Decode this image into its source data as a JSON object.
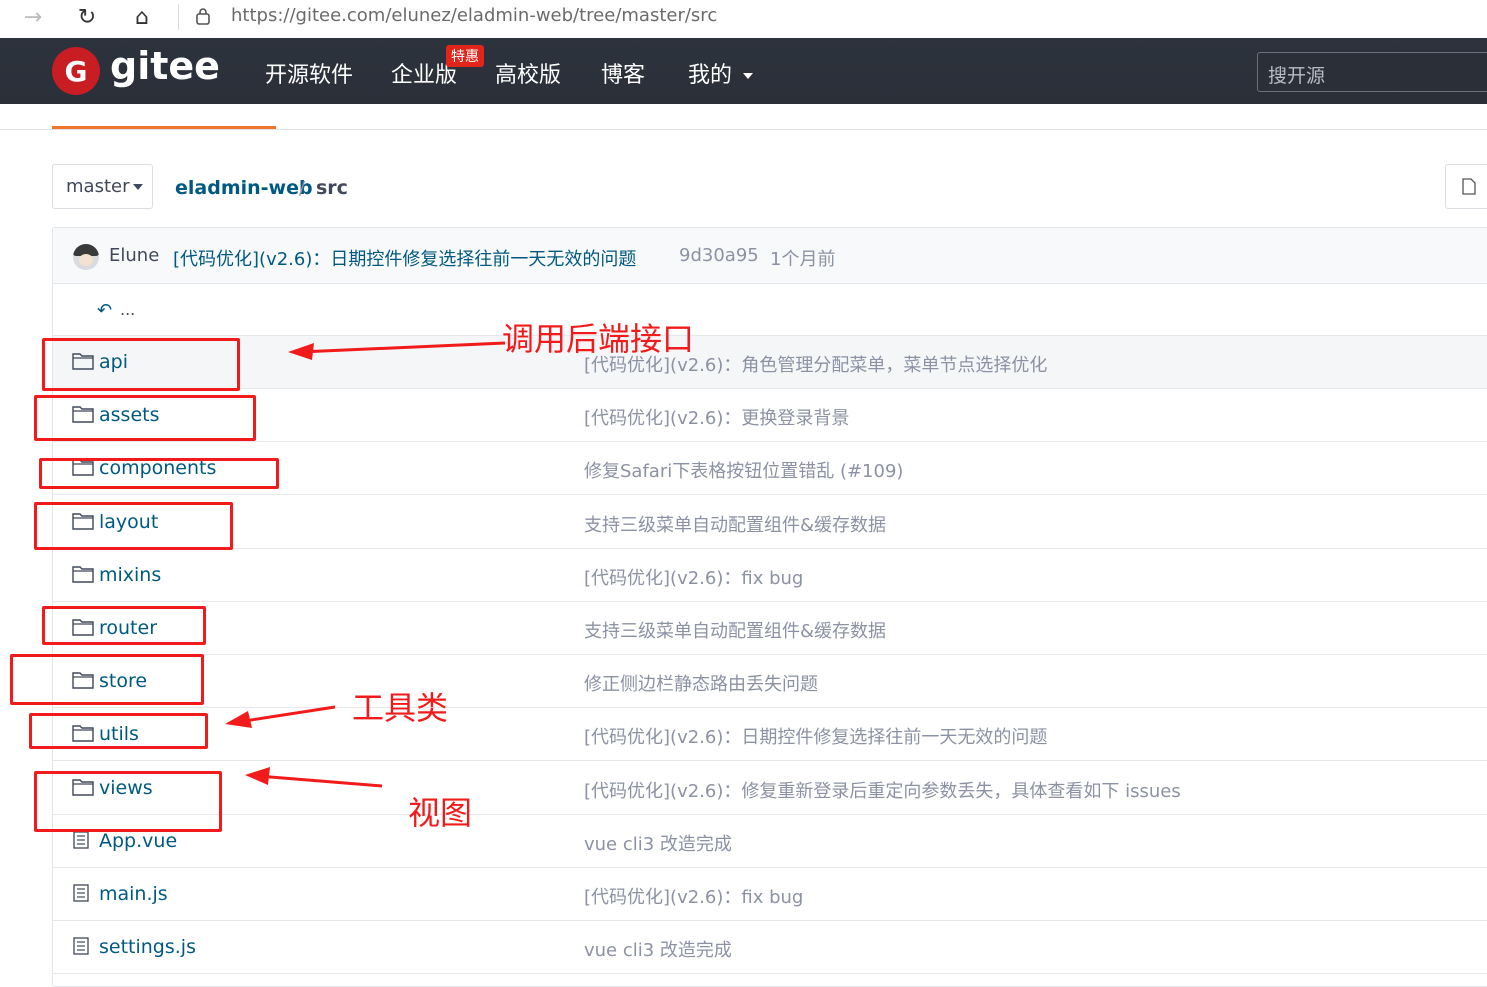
{
  "browser": {
    "url": "https://gitee.com/elunez/eladmin-web/tree/master/src",
    "back_icon": "→",
    "reload_icon": "↻",
    "home_icon": "⌂"
  },
  "header": {
    "logo_letter": "G",
    "logo_text": "gitee",
    "nav": [
      "开源软件",
      "企业版",
      "高校版",
      "博客",
      "我的"
    ],
    "badge": "特惠",
    "search_placeholder": "搜开源"
  },
  "repo": {
    "branch": "master",
    "repo_name": "eladmin-web",
    "separator": "/",
    "current_dir": "src"
  },
  "last_commit": {
    "author": "Elune",
    "message": "[代码优化](v2.6)：日期控件修复选择往前一天无效的问题",
    "sha": "9d30a95",
    "time": "1个月前"
  },
  "parent_dir": "...",
  "files": [
    {
      "name": "api",
      "type": "folder",
      "message": "[代码优化](v2.6)：角色管理分配菜单，菜单节点选择优化"
    },
    {
      "name": "assets",
      "type": "folder",
      "message": "[代码优化](v2.6)：更换登录背景"
    },
    {
      "name": "components",
      "type": "folder",
      "message": "修复Safari下表格按钮位置错乱 (#109)"
    },
    {
      "name": "layout",
      "type": "folder",
      "message": "支持三级菜单自动配置组件&缓存数据"
    },
    {
      "name": "mixins",
      "type": "folder",
      "message": "[代码优化](v2.6)：fix bug"
    },
    {
      "name": "router",
      "type": "folder",
      "message": "支持三级菜单自动配置组件&缓存数据"
    },
    {
      "name": "store",
      "type": "folder",
      "message": "修正侧边栏静态路由丢失问题"
    },
    {
      "name": "utils",
      "type": "folder",
      "message": "[代码优化](v2.6)：日期控件修复选择往前一天无效的问题"
    },
    {
      "name": "views",
      "type": "folder",
      "message": "[代码优化](v2.6)：修复重新登录后重定向参数丢失，具体查看如下 issues"
    },
    {
      "name": "App.vue",
      "type": "file",
      "message": "vue cli3 改造完成"
    },
    {
      "name": "main.js",
      "type": "file",
      "message": "[代码优化](v2.6)：fix bug"
    },
    {
      "name": "settings.js",
      "type": "file",
      "message": "vue cli3 改造完成"
    }
  ],
  "annotations": {
    "api_label": "调用后端接口",
    "utils_label": "工具类",
    "views_label": "视图",
    "color": "#f21b1b"
  }
}
